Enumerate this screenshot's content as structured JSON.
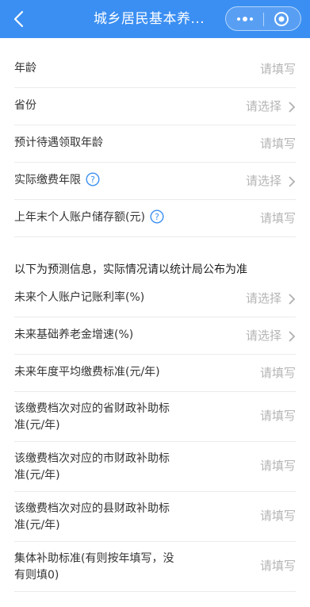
{
  "nav": {
    "title": "城乡居民基本养..."
  },
  "colors": {
    "nav_bg": "#3b8ff2",
    "help_icon": "#3b8ff2",
    "placeholder": "#b5b5b5"
  },
  "rows_top": [
    {
      "label": "年龄",
      "value": "请填写"
    },
    {
      "label": "省份",
      "value": "请选择"
    },
    {
      "label": "预计待遇领取年龄",
      "value": "请填写"
    },
    {
      "label": "实际缴费年限",
      "value": "请选择"
    },
    {
      "label": "上年末个人账户储存额(元)",
      "value": "请填写"
    }
  ],
  "section_title": "以下为预测信息，实际情况请以统计局公布为准",
  "rows_bottom": [
    {
      "label": "未来个人账户记账利率(%)",
      "value": "请选择"
    },
    {
      "label": "未来基础养老金增速(%)",
      "value": "请选择"
    },
    {
      "label": "未来年度平均缴费标准(元/年)",
      "value": "请填写"
    },
    {
      "label_line1": "该缴费档次对应的省财政补助标",
      "label_line2": "准(元/年)",
      "value": "请填写"
    },
    {
      "label_line1": "该缴费档次对应的市财政补助标",
      "label_line2": "准(元/年)",
      "value": "请填写"
    },
    {
      "label_line1": "该缴费档次对应的县财政补助标",
      "label_line2": "准(元/年)",
      "value": "请填写"
    },
    {
      "label_line1": "集体补助标准(有则按年填写，没",
      "label_line2": "有则填0)",
      "value": "请填写"
    }
  ]
}
